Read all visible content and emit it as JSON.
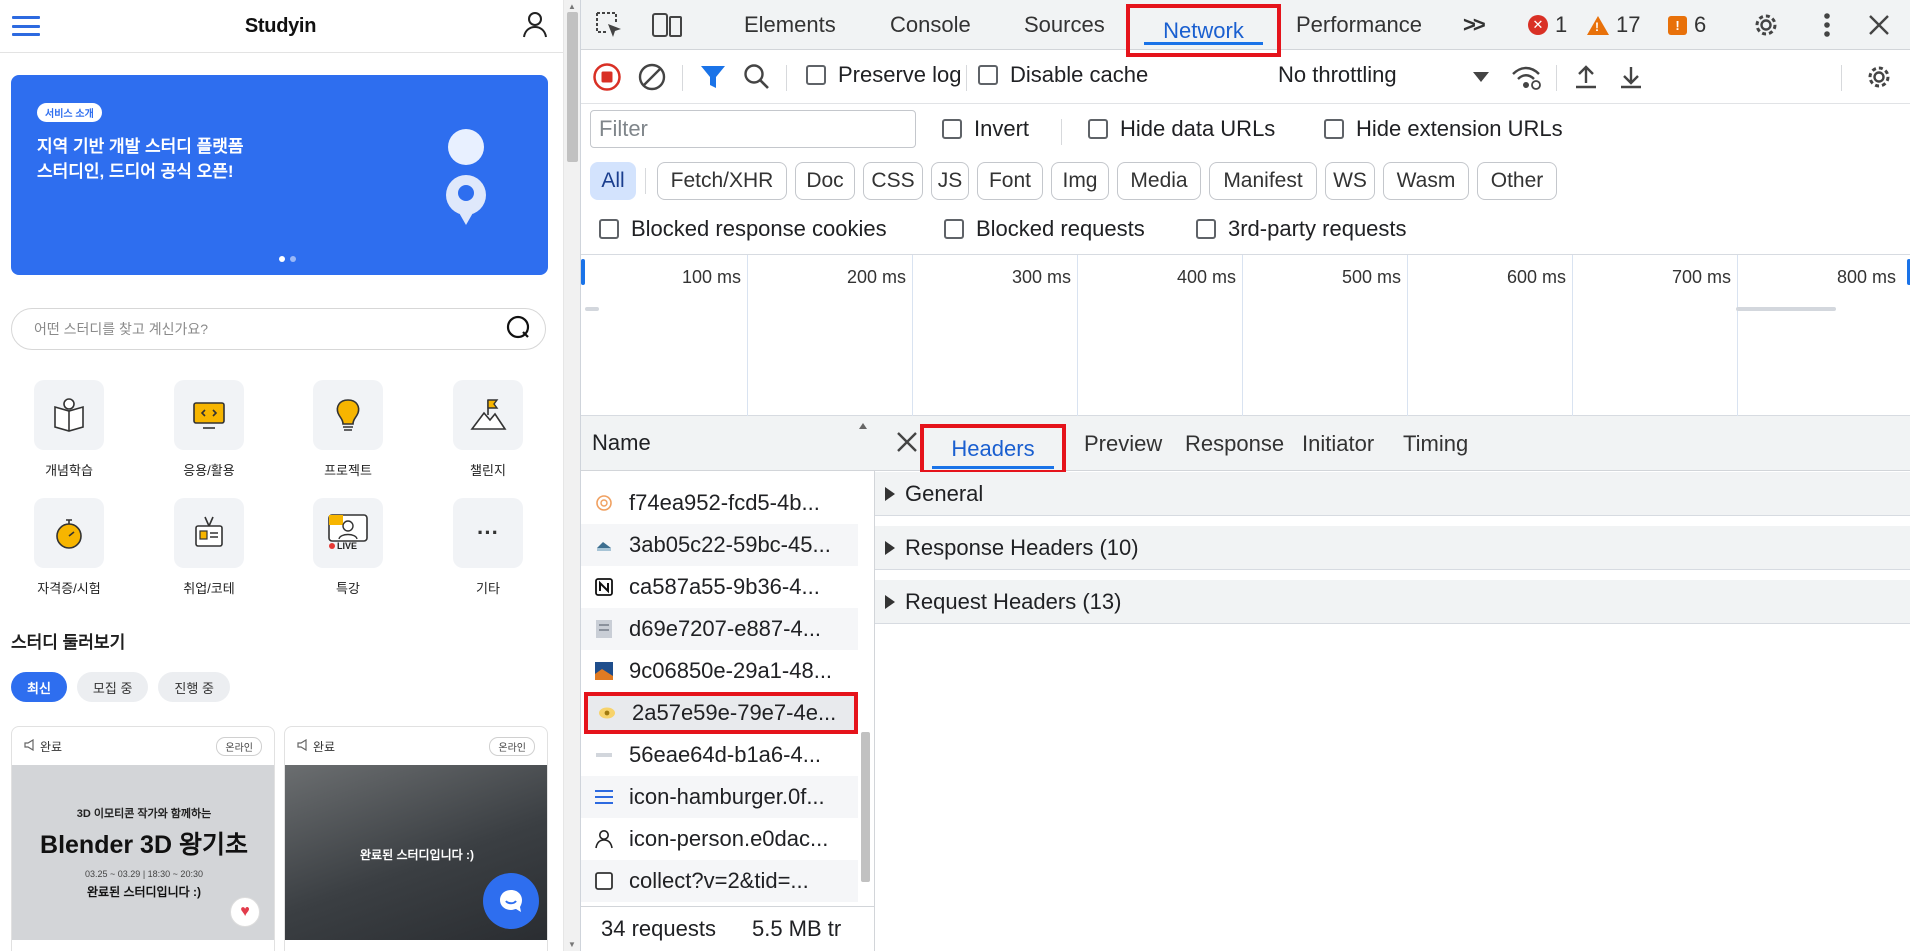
{
  "site": {
    "brand": "Studyin",
    "banner": {
      "tag": "서비스 소개",
      "title": "지역 기반 개발 스터디 플랫폼\n스터디인, 드디어 공식 오픈!"
    },
    "search_placeholder": "어떤 스터디를 찾고 계신가요?",
    "categories": [
      {
        "label": "개념학습",
        "icon": "book-icon"
      },
      {
        "label": "응용/활용",
        "icon": "code-monitor-icon"
      },
      {
        "label": "프로젝트",
        "icon": "lightbulb-icon"
      },
      {
        "label": "챌린지",
        "icon": "flag-mountain-icon"
      },
      {
        "label": "자격증/시험",
        "icon": "stopwatch-icon"
      },
      {
        "label": "취업/코테",
        "icon": "id-card-icon"
      },
      {
        "label": "특강",
        "icon": "live-icon"
      },
      {
        "label": "기타",
        "icon": "more-icon"
      }
    ],
    "live_text": "LIVE",
    "more_text": "···",
    "section_title": "스터디 둘러보기",
    "chips": [
      "최신",
      "모집 중",
      "진행 중"
    ],
    "cards": [
      {
        "status": "완료",
        "online": "온라인",
        "subtitle": "3D 이모티콘 작가와 함께하는",
        "title": "Blender 3D 왕기초",
        "date": "03.25 ~ 03.29 | 18:30 ~ 20:30",
        "overlay": "완료된 스터디입니다 :)"
      },
      {
        "status": "완료",
        "online": "온라인",
        "overlay": "완료된 스터디입니다 :)"
      }
    ]
  },
  "devtools": {
    "tabs": [
      "Elements",
      "Console",
      "Sources",
      "Network",
      "Performance"
    ],
    "more_tabs": ">>",
    "errors": "1",
    "warnings": "17",
    "issues": "6",
    "toolbar": {
      "preserve_log": "Preserve log",
      "disable_cache": "Disable cache",
      "throttling": "No throttling"
    },
    "filter": {
      "placeholder": "Filter",
      "invert": "Invert",
      "hide_data_urls": "Hide data URLs",
      "hide_extension_urls": "Hide extension URLs"
    },
    "types": [
      "All",
      "Fetch/XHR",
      "Doc",
      "CSS",
      "JS",
      "Font",
      "Img",
      "Media",
      "Manifest",
      "WS",
      "Wasm",
      "Other"
    ],
    "blocked": {
      "cookies": "Blocked response cookies",
      "requests": "Blocked requests",
      "third_party": "3rd-party requests"
    },
    "timeline_ticks": [
      "100 ms",
      "200 ms",
      "300 ms",
      "400 ms",
      "500 ms",
      "600 ms",
      "700 ms",
      "800 ms"
    ],
    "name_header": "Name",
    "requests": [
      {
        "name": "f74ea952-fcd5-4b...",
        "icon": "image-thumb-icon"
      },
      {
        "name": "3ab05c22-59bc-45...",
        "icon": "image-thumb-icon"
      },
      {
        "name": "ca587a55-9b36-4...",
        "icon": "notion-icon"
      },
      {
        "name": "d69e7207-e887-4...",
        "icon": "image-thumb-icon"
      },
      {
        "name": "9c06850e-29a1-48...",
        "icon": "image-thumb-icon"
      },
      {
        "name": "2a57e59e-79e7-4e...",
        "icon": "image-thumb-icon"
      },
      {
        "name": "56eae64d-b1a6-4...",
        "icon": "image-thumb-icon"
      },
      {
        "name": "icon-hamburger.0f...",
        "icon": "hamburger-icon"
      },
      {
        "name": "icon-person.e0dac...",
        "icon": "person-icon"
      },
      {
        "name": "collect?v=2&tid=...",
        "icon": "document-icon"
      }
    ],
    "status": {
      "requests": "34 requests",
      "transferred": "5.5 MB tr"
    },
    "detail_tabs": [
      "Headers",
      "Preview",
      "Response",
      "Initiator",
      "Timing"
    ],
    "sections": [
      "General",
      "Response Headers (10)",
      "Request Headers (13)"
    ]
  }
}
